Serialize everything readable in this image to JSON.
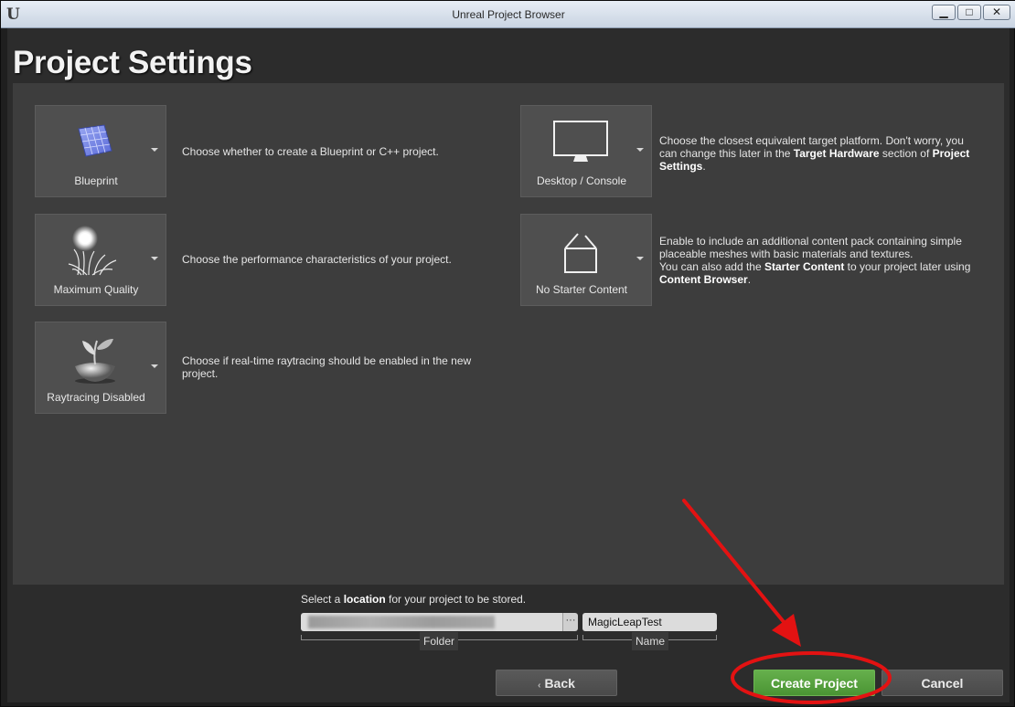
{
  "window": {
    "title": "Unreal Project Browser",
    "logo_glyph": "U",
    "minimize_glyph": "▁",
    "maximize_glyph": "□",
    "close_glyph": "✕"
  },
  "page": {
    "heading": "Project Settings"
  },
  "options": {
    "project_type": {
      "label": "Blueprint",
      "icon": "blueprint-icon",
      "description": "Choose whether to create a Blueprint or C++ project."
    },
    "quality": {
      "label": "Maximum Quality",
      "icon": "maximum-quality-icon",
      "description": "Choose the performance characteristics of your project."
    },
    "raytracing": {
      "label": "Raytracing Disabled",
      "icon": "raytracing-disabled-icon",
      "description": "Choose if real-time raytracing should be enabled in the new project."
    },
    "platform": {
      "label": "Desktop / Console",
      "icon": "desktop-monitor-icon",
      "description_part1": "Choose the closest equivalent target platform. Don't worry, you can change this later in the ",
      "description_bold1": "Target Hardware",
      "description_part2": " section of ",
      "description_bold2": "Project Settings",
      "description_part3": "."
    },
    "starter_content": {
      "label": "No Starter Content",
      "icon": "open-box-icon",
      "description_line1": "Enable to include an additional content pack containing simple placeable meshes with basic materials and textures.",
      "description_part1": "You can also add the ",
      "description_bold1": "Starter Content",
      "description_part2": " to your project later using ",
      "description_bold2": "Content Browser",
      "description_part3": "."
    }
  },
  "location": {
    "label_part1": "Select a ",
    "label_bold": "location",
    "label_part2": " for your project to be stored.",
    "browse_glyph": "···",
    "folder_tag": "Folder",
    "name_value": "MagicLeapTest",
    "name_tag": "Name"
  },
  "buttons": {
    "back": "Back",
    "back_glyph": "‹",
    "create": "Create Project",
    "cancel": "Cancel"
  },
  "colors": {
    "create_button": "#4a9434",
    "annotation": "#e31212"
  }
}
